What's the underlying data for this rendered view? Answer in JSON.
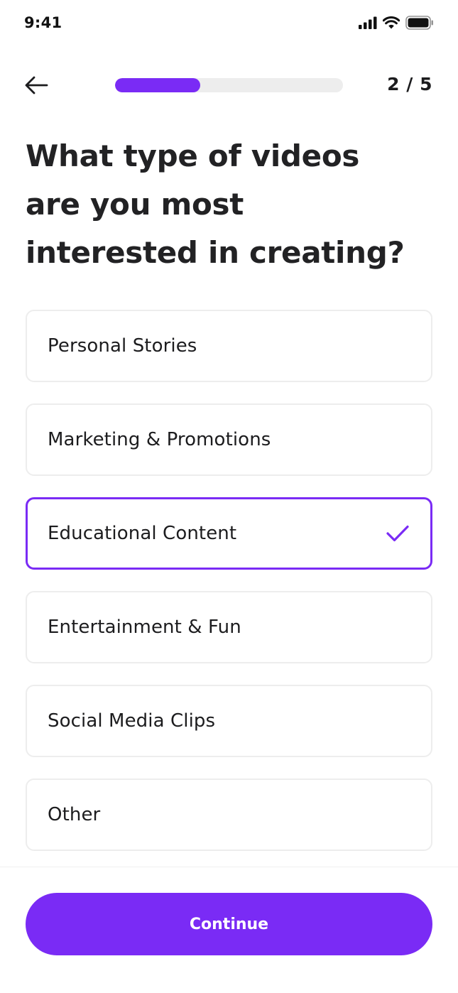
{
  "status_bar": {
    "time": "9:41",
    "icons": [
      "signal-icon",
      "wifi-icon",
      "battery-icon"
    ]
  },
  "header": {
    "back_icon": "arrow-left-icon",
    "progress": {
      "current": 2,
      "total": 5,
      "fraction": 0.375
    },
    "step_label": "2 / 5"
  },
  "question": "What type of videos are you most interested in creating?",
  "options": [
    {
      "label": "Personal Stories",
      "selected": false
    },
    {
      "label": "Marketing & Promotions",
      "selected": false
    },
    {
      "label": "Educational Content",
      "selected": true
    },
    {
      "label": "Entertainment & Fun",
      "selected": false
    },
    {
      "label": "Social Media Clips",
      "selected": false
    },
    {
      "label": "Other",
      "selected": false
    }
  ],
  "continue_label": "Continue",
  "colors": {
    "accent": "#7a2bf5",
    "progress_track": "#ededed",
    "option_border": "#ededed",
    "text": "#1c1c1e"
  }
}
